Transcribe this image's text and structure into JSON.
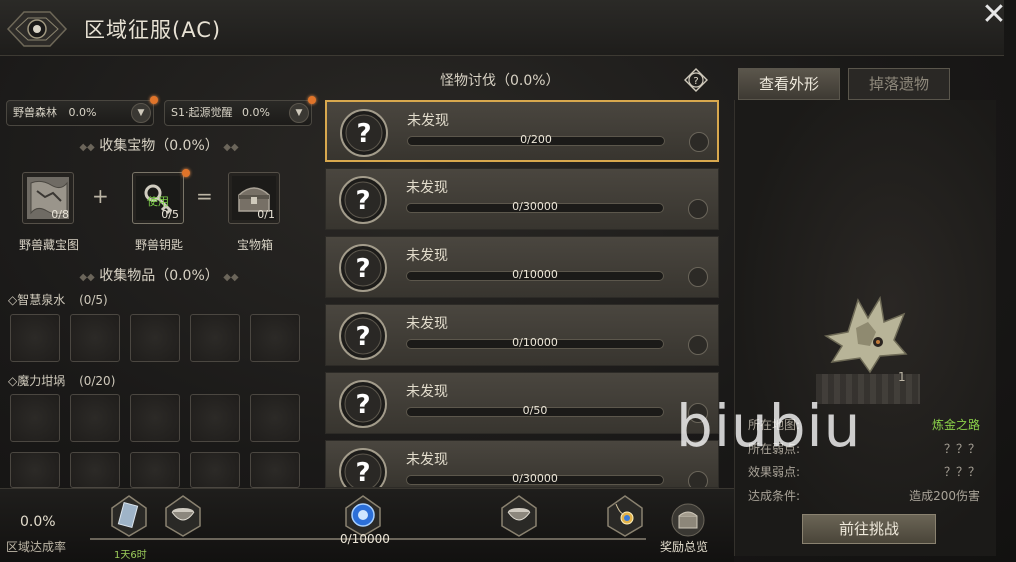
{
  "window": {
    "title": "区域征服(AC)",
    "close_label": "✕"
  },
  "left": {
    "dropdowns": [
      {
        "label": "野兽森林",
        "value": "0.0%"
      },
      {
        "label": "S1·起源觉醒",
        "value": "0.0%"
      }
    ],
    "treasure_header": "收集宝物（0.0%）",
    "treasure_items": [
      {
        "name": "野兽藏宝图",
        "count": "0/8"
      },
      {
        "name": "野兽钥匙",
        "count": "0/5",
        "badge": "使用"
      },
      {
        "name": "宝物箱",
        "count": "0/1"
      }
    ],
    "ops": [
      "+",
      "="
    ],
    "items_header": "收集物品（0.0%）",
    "groups": [
      {
        "name": "◇智慧泉水",
        "progress": "(0/5)"
      },
      {
        "name": "◇魔力坩埚",
        "progress": "(0/20)"
      }
    ]
  },
  "middle": {
    "header": "怪物讨伐（0.0%）",
    "help_icon": "question-circle-icon",
    "monsters": [
      {
        "name": "未发现",
        "progress": "0/200",
        "selected": true
      },
      {
        "name": "未发现",
        "progress": "0/30000"
      },
      {
        "name": "未发现",
        "progress": "0/10000"
      },
      {
        "name": "未发现",
        "progress": "0/10000"
      },
      {
        "name": "未发现",
        "progress": "0/50"
      },
      {
        "name": "未发现",
        "progress": "0/30000"
      }
    ]
  },
  "right": {
    "tabs": [
      "查看外形",
      "掉落遗物"
    ],
    "name_suffix": "1",
    "info": [
      {
        "label": "所在地图:",
        "value": "炼金之路"
      },
      {
        "label": "所在弱点:",
        "value": "？？？"
      },
      {
        "label": "效果弱点:",
        "value": "？？？"
      },
      {
        "label": "达成条件:",
        "value": "造成200伤害"
      }
    ],
    "go_button": "前往挑战",
    "watermark": "biubiu"
  },
  "bottom": {
    "rate_value": "0.0%",
    "rate_label": "区域达成率",
    "progress_fraction": 0.0,
    "time_label": "1天6时",
    "count_label": "0/10000",
    "overview_label": "奖励总览"
  },
  "colors": {
    "accent_gold": "#d8a84e",
    "green_text": "#8bd24a",
    "notify_dot": "#e0742a"
  }
}
